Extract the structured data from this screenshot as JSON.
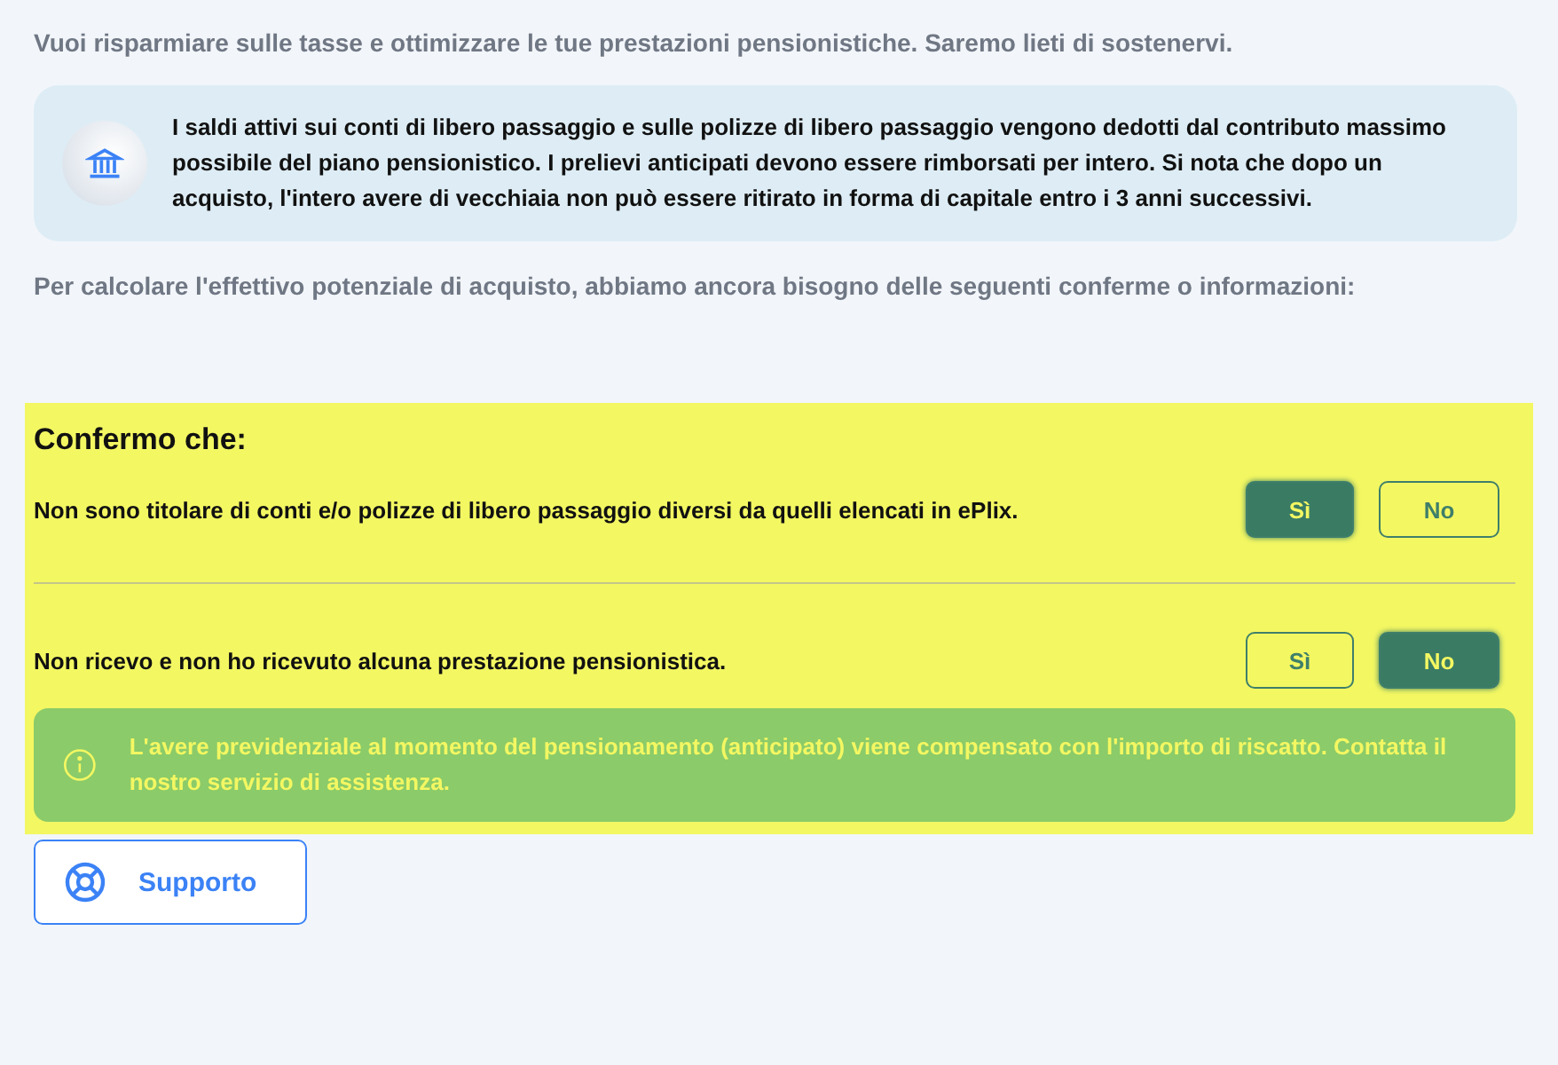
{
  "intro": "Vuoi risparmiare sulle tasse e ottimizzare le tue prestazioni pensionistiche. Saremo lieti di sostenervi.",
  "info_box": {
    "text": "I saldi attivi sui conti di libero passaggio e sulle polizze di libero passaggio vengono dedotti dal contributo massimo possibile del piano pensionistico. I prelievi anticipati devono essere rimborsati per intero. Si nota che dopo un acquisto, l'intero avere di vecchiaia non può essere ritirato in forma di capitale entro i 3 anni successivi."
  },
  "request": "Per calcolare l'effettivo potenziale di acquisto, abbiamo ancora bisogno delle seguenti conferme o informazioni:",
  "confirm": {
    "title": "Confermo che:",
    "questions": [
      {
        "text": "Non sono titolare di conti e/o polizze di libero passaggio diversi da quelli elencati in ePlix.",
        "options": [
          {
            "label": "Sì",
            "selected": true
          },
          {
            "label": "No",
            "selected": false
          }
        ]
      },
      {
        "text": "Non ricevo e non ho ricevuto alcuna prestazione pensionistica.",
        "options": [
          {
            "label": "Sì",
            "selected": false
          },
          {
            "label": "No",
            "selected": true
          }
        ]
      }
    ],
    "notice": {
      "text": "L'avere previdenziale al momento del pensionamento (anticipato) viene compensato con l'importo di riscatto. Contatta il nostro servizio di assistenza."
    }
  },
  "support_button": "Supporto"
}
